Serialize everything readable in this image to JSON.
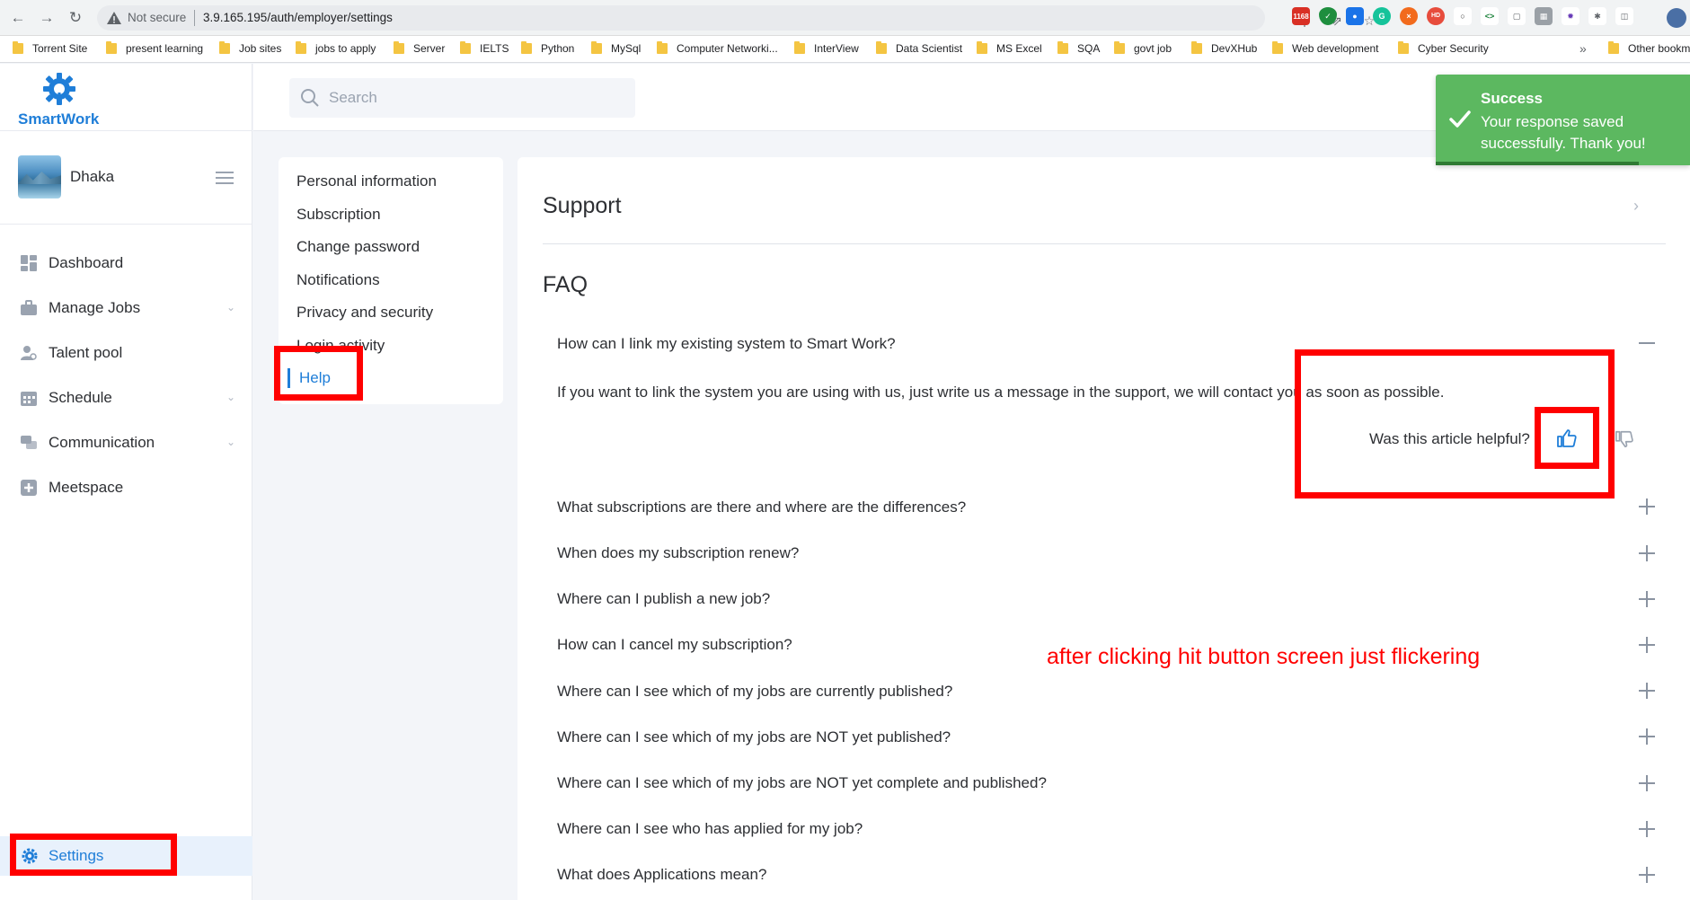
{
  "browser": {
    "not_secure": "Not secure",
    "url": "3.9.165.195/auth/employer/settings",
    "bookmarks": [
      "Torrent Site",
      "present learning",
      "Job sites",
      "jobs to apply",
      "Server",
      "IELTS",
      "Python",
      "MySql",
      "Computer Networki...",
      "InterView",
      "Data Scientist",
      "MS Excel",
      "SQA",
      "govt job",
      "DevXHub",
      "Web development",
      "Cyber Security"
    ],
    "more": "»",
    "other_bookmarks": "Other bookm",
    "gmail_badge": "1168"
  },
  "app": {
    "brand": "SmartWork",
    "user_name": "Dhaka",
    "search_placeholder": "Search",
    "nav": [
      {
        "label": "Dashboard",
        "icon": "dashboard-icon"
      },
      {
        "label": "Manage Jobs",
        "icon": "briefcase-icon"
      },
      {
        "label": "Talent pool",
        "icon": "users-icon"
      },
      {
        "label": "Schedule",
        "icon": "calendar-icon"
      },
      {
        "label": "Communication",
        "icon": "chat-icon"
      },
      {
        "label": "Meetspace",
        "icon": "meetspace-icon"
      }
    ],
    "settings_label": "Settings"
  },
  "settings_menu": {
    "items": [
      "Personal information",
      "Subscription",
      "Change password",
      "Notifications",
      "Privacy and security",
      "Login activity"
    ],
    "active": "Help"
  },
  "main": {
    "section_title": "Support",
    "faq_title": "FAQ",
    "expanded_question": "How can I link my existing system to Smart Work?",
    "expanded_answer": "If you want to link the system you are using with us, just write us a message in the support, we will contact you as soon as possible.",
    "helpful_label": "Was this article helpful?",
    "questions": [
      "What subscriptions are there and where are the differences?",
      "When does my subscription renew?",
      "Where can I publish a new job?",
      "How can I cancel my subscription?",
      "Where can I see which of my jobs are currently published?",
      "Where can I see which of my jobs are NOT yet published?",
      "Where can I see which of my jobs are NOT yet complete and published?",
      "Where can I see who has applied for my job?",
      "What does Applications mean?"
    ]
  },
  "toast": {
    "title": "Success",
    "message": "Your response saved successfully. Thank you!"
  },
  "annotation": {
    "note": "after clicking hit button screen just flickering"
  },
  "colors": {
    "accent": "#1f7ed8",
    "success": "#5cb860",
    "annotation": "#ff0000"
  }
}
